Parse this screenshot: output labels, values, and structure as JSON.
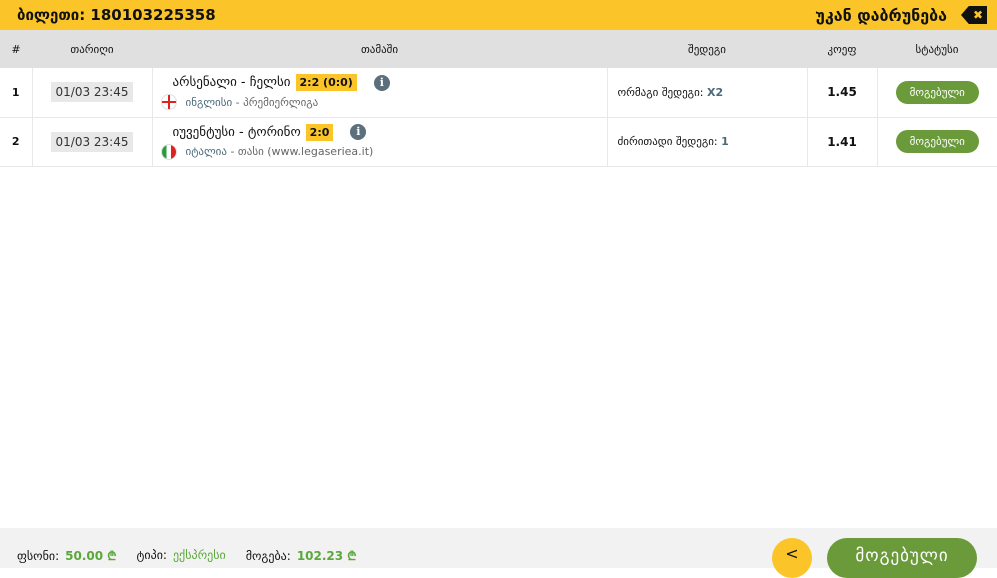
{
  "header": {
    "ticket_label": "ბილეთი: 180103225358",
    "back_label": "უკან დაბრუნება",
    "back_icon": "✖"
  },
  "table": {
    "columns": [
      "#",
      "თარიღი",
      "თამაში",
      "შედეგი",
      "კოეფ",
      "სტატუსი"
    ],
    "rows": [
      {
        "num": "1",
        "date": "01/03 23:45",
        "teams": "არსენალი - ჩელსი",
        "score": "2:2 (0:0)",
        "country": "ინგლისი",
        "league": " - პრემიერლიგა",
        "result_label": "ორმაგი შედეგი:",
        "result_value": "X2",
        "odd": "1.45",
        "status": "მოგებული"
      },
      {
        "num": "2",
        "date": "01/03 23:45",
        "teams": "იუვენტუსი - ტორინო",
        "score": "2:0",
        "country": "იტალია",
        "league": " - თასი (www.legaseriea.it)",
        "result_label": "ძირითადი შედეგი:",
        "result_value": "1",
        "odd": "1.41",
        "status": "მოგებული"
      }
    ]
  },
  "footer": {
    "stake_label": "ფსონი:",
    "stake": "50.00 ₾",
    "type_label": "ტიპი:",
    "type": "ექსპრესი",
    "win_label": "მოგება:",
    "win": "102.23 ₾",
    "status_button": "მოგებული"
  },
  "colors": {
    "accent": "#fbc52a",
    "success": "#6a9a3a"
  }
}
